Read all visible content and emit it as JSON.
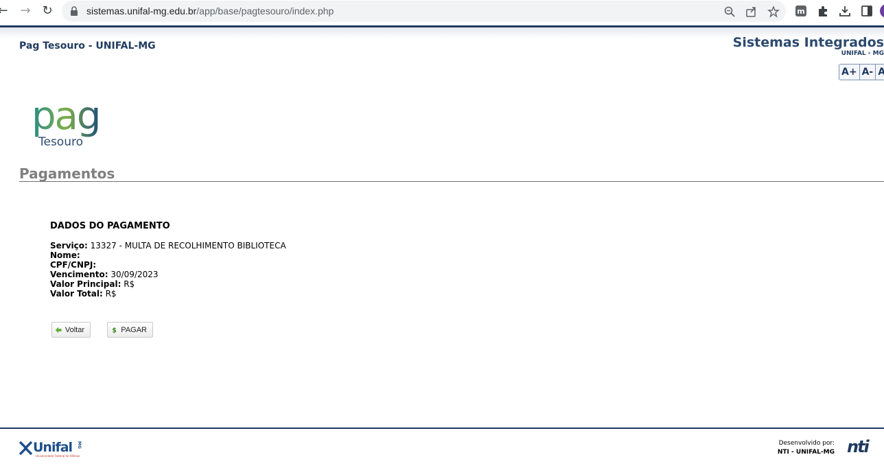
{
  "browser": {
    "url_host": "sistemas.unifal-mg.edu.br",
    "url_path": "/app/base/pagtesouro/index.php",
    "icons": [
      "back-icon",
      "forward-icon",
      "reload-icon",
      "lock-icon",
      "zoom-icon",
      "share-icon",
      "bookmark-star-icon",
      "extension-m-icon",
      "extensions-puzzle-icon",
      "download-icon",
      "side-panel-icon",
      "profile-avatar"
    ]
  },
  "header": {
    "site_title": "Pag Tesouro - UNIFAL-MG",
    "system_title": "Sistemas Integrados",
    "system_subtitle": "UNIFAL - MG",
    "font_increase": "A+",
    "font_decrease": "A-",
    "font_reset": "A"
  },
  "logo": {
    "main": "pag",
    "sub": "Tesouro"
  },
  "page": {
    "section_title": "Pagamentos"
  },
  "payment": {
    "heading": "DADOS DO PAGAMENTO",
    "fields": [
      {
        "label": "Serviço:",
        "value": "13327 - MULTA DE RECOLHIMENTO BIBLIOTECA"
      },
      {
        "label": "Nome:",
        "value": ""
      },
      {
        "label": "CPF/CNPJ:",
        "value": ""
      },
      {
        "label": "Vencimento:",
        "value": "30/09/2023"
      },
      {
        "label": "Valor Principal:",
        "value": "R$"
      },
      {
        "label": "Valor Total:",
        "value": "R$"
      }
    ]
  },
  "actions": {
    "back_label": "Voltar",
    "pay_label": "PAGAR"
  },
  "footer": {
    "unifal_logo": "Unifal",
    "unifal_logo_suffix": "MG",
    "unifal_tagline": "Universidade Federal de Alfenas",
    "developed_by": "Desenvolvido por:",
    "developer_org": "NTI - UNIFAL-MG",
    "nti_logo": "nti"
  },
  "colors": {
    "brand_navy": "#1f3a5f",
    "section_gray": "#808080",
    "logo_teal": "#2a8c86",
    "logo_gold": "#d6a21c"
  }
}
